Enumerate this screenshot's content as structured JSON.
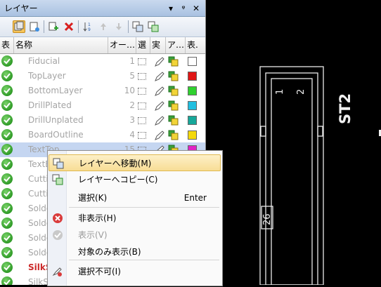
{
  "panel": {
    "title": "レイヤー",
    "title_buttons": [
      "▾",
      "ᵠ",
      "✕"
    ],
    "columns": [
      "表",
      "名称",
      "オー…",
      "選",
      "実",
      "ア…",
      "表."
    ],
    "layers": [
      {
        "name": "Fiducial",
        "order": "1",
        "color": "#ffffff"
      },
      {
        "name": "TopLayer",
        "order": "5",
        "color": "#e01616"
      },
      {
        "name": "BottomLayer",
        "order": "10",
        "color": "#2fd12f"
      },
      {
        "name": "DrillPlated",
        "order": "2",
        "color": "#21bfe0"
      },
      {
        "name": "DrillUnplated",
        "order": "3",
        "color": "#17a89a"
      },
      {
        "name": "BoardOutline",
        "order": "4",
        "color": "#f4d90c"
      },
      {
        "name": "TextTop",
        "order": "15",
        "color": "#e024c6"
      },
      {
        "name": "TextB",
        "order": "",
        "color": ""
      },
      {
        "name": "Cuttin",
        "order": "",
        "color": ""
      },
      {
        "name": "Cuttin",
        "order": "",
        "color": ""
      },
      {
        "name": "Solder",
        "order": "",
        "color": ""
      },
      {
        "name": "Solder",
        "order": "",
        "color": ""
      },
      {
        "name": "Solder",
        "order": "",
        "color": ""
      },
      {
        "name": "Solder",
        "order": "",
        "color": ""
      },
      {
        "name": "SilkS",
        "order": "",
        "color": ""
      },
      {
        "name": "SilkSc",
        "order": "",
        "color": ""
      }
    ]
  },
  "context_menu": {
    "items": [
      {
        "label": "レイヤーへ移動(M)",
        "shortcut": "",
        "icon": "move-layer-icon",
        "highlighted": true,
        "disabled": false
      },
      {
        "label": "レイヤーへコピー(C)",
        "shortcut": "",
        "icon": "copy-layer-icon",
        "highlighted": false,
        "disabled": false
      },
      {
        "label": "選択(K)",
        "shortcut": "Enter",
        "icon": "",
        "highlighted": false,
        "disabled": false
      },
      {
        "label": "非表示(H)",
        "shortcut": "",
        "icon": "hide-icon",
        "highlighted": false,
        "disabled": false
      },
      {
        "label": "表示(V)",
        "shortcut": "",
        "icon": "show-icon",
        "highlighted": false,
        "disabled": true
      },
      {
        "label": "対象のみ表示(B)",
        "shortcut": "",
        "icon": "",
        "highlighted": false,
        "disabled": false
      },
      {
        "label": "選択不可(I)",
        "shortcut": "",
        "icon": "unselectable-icon",
        "highlighted": false,
        "disabled": false
      }
    ]
  },
  "canvas": {
    "labels": {
      "pin1": "1",
      "pin2": "2",
      "ref": "ST2",
      "pin26": "26"
    }
  }
}
